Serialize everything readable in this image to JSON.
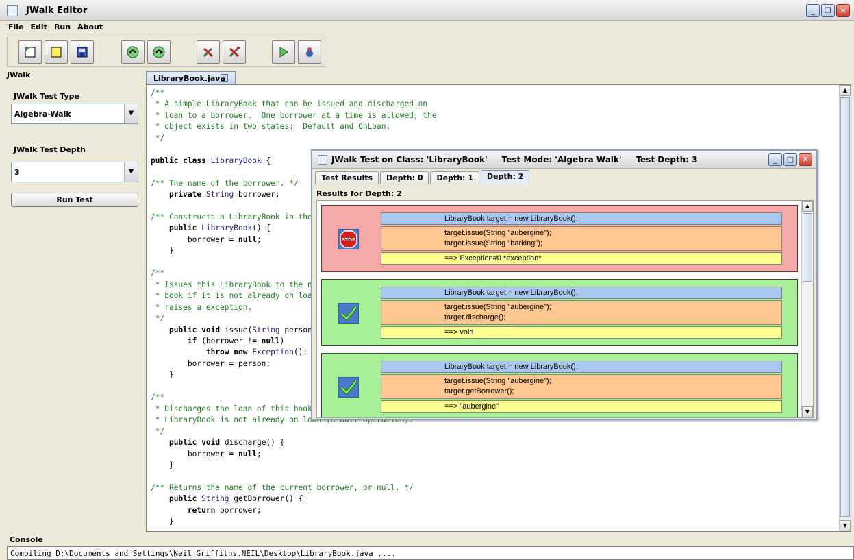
{
  "window": {
    "title": "JWalk Editor"
  },
  "menu": [
    "File",
    "Edit",
    "Run",
    "About"
  ],
  "toolbar": {
    "buttons": [
      "new-file-icon",
      "open-file-icon",
      "save-icon",
      "undo-icon",
      "redo-icon",
      "compile-icon",
      "compile-all-icon",
      "run-icon",
      "debug-icon"
    ]
  },
  "left": {
    "panel_title": "JWalk",
    "test_type_label": "JWalk Test Type",
    "test_type_value": "Algebra-Walk",
    "test_depth_label": "JWalk Test Depth",
    "test_depth_value": "3",
    "run_button": "Run Test"
  },
  "editor": {
    "tab": "LibraryBook.java",
    "code": [
      "/**",
      " * A simple LibraryBook that can be issued and discharged on",
      " * loan to a borrower.  One borrower at a time is allowed; the",
      " * object exists in two states:  Default and OnLoan.",
      " */",
      "",
      "public class LibraryBook {",
      "",
      "/** The name of the borrower. */",
      "    private String borrower;",
      "",
      "/** Constructs a LibraryBook in the Default state. */",
      "    public LibraryBook() {",
      "        borrower = null;",
      "    }",
      "",
      "/**",
      " * Issues this LibraryBook to the named person.  Issues the",
      " * book if it is not already on loan; otherwise",
      " * raises a exception.",
      " */",
      "    public void issue(String person) {",
      "        if (borrower != null)",
      "            throw new Exception();",
      "        borrower = person;",
      "    }",
      "",
      "/**",
      " * Discharges the loan of this book.  Does nothing if the",
      " * LibraryBook is not already on loan (a null operation).",
      " */",
      "    public void discharge() {",
      "        borrower = null;",
      "    }",
      "",
      "/** Returns the name of the current borrower, or null. */",
      "    public String getBorrower() {",
      "        return borrower;",
      "    }"
    ]
  },
  "console": {
    "title": "Console",
    "text": "Compiling D:\\Documents and Settings\\Neil Griffiths.NEIL\\Desktop\\LibraryBook.java ...."
  },
  "dialog": {
    "title": "JWalk Test on Class: 'LibraryBook'     Test Mode: 'Algebra Walk'     Test Depth: 3",
    "tabs": [
      "Test Results",
      "Depth: 0",
      "Depth: 1",
      "Depth: 2"
    ],
    "results_label": "Results for Depth: 2",
    "results": [
      {
        "status": "fail",
        "ctor": "LibraryBook target = new LibraryBook();",
        "calls": [
          "target.issue(String \"aubergine\");",
          "target.issue(String \"barking\");"
        ],
        "result": "==> Exception#0  *exception*"
      },
      {
        "status": "pass",
        "ctor": "LibraryBook target = new LibraryBook();",
        "calls": [
          "target.issue(String \"aubergine\");",
          "target.discharge();"
        ],
        "result": "==> void"
      },
      {
        "status": "pass",
        "ctor": "LibraryBook target = new LibraryBook();",
        "calls": [
          "target.issue(String \"aubergine\");",
          "target.getBorrower();"
        ],
        "result": "==> \"aubergine\""
      }
    ],
    "stop_label": "STOP"
  },
  "colors": {
    "fail": "#f4a8a8",
    "pass": "#a8f098",
    "ctor": "#a8c8f0",
    "calls": "#ffc890",
    "result": "#ffff90",
    "comment": "#208020"
  }
}
